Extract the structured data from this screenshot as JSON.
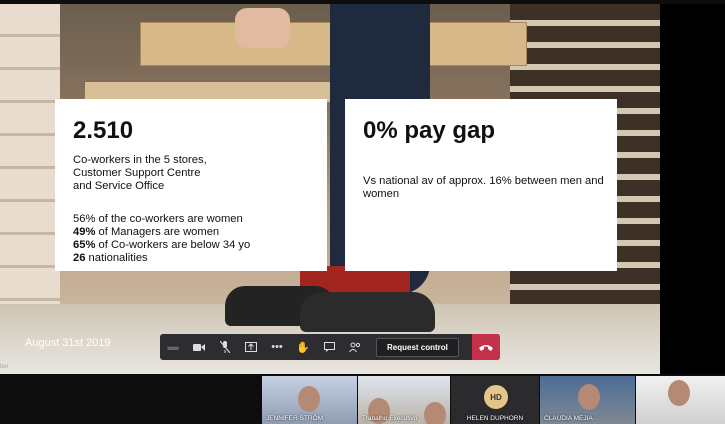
{
  "slide": {
    "card_left": {
      "headline": "2.510",
      "desc_lines": [
        "Co-workers in the 5 stores,",
        "Customer Support Centre",
        "and Service Office"
      ],
      "stats": [
        {
          "bold": "",
          "text": "56% of the co-workers are women"
        },
        {
          "bold": "49%",
          "text": " of Managers are women"
        },
        {
          "bold": "65%",
          "text": " of Co-workers are below 34 yo"
        },
        {
          "bold": "26",
          "text": " nationalities"
        }
      ]
    },
    "card_right": {
      "headline": "0% pay gap",
      "desc_lines": [
        "Vs national av of approx. 16% between men and",
        "women"
      ]
    },
    "date": "August 31st 2019"
  },
  "toolbar": {
    "icons": [
      "screen-icon",
      "camera-icon",
      "mic-off-icon",
      "share-icon",
      "more-icon",
      "raise-hand-icon",
      "chat-icon",
      "participants-icon"
    ],
    "request_control_label": "Request control",
    "hangup_icon": "phone-hangup-icon"
  },
  "corner_label": "ber",
  "participants": [
    {
      "name": "JENNIFER STRÖM"
    },
    {
      "name": "Trabalho Executivo"
    },
    {
      "name": "HELEN DUPHORN",
      "initials": "HD"
    },
    {
      "name": "CLAUDIA MEJIA"
    },
    {
      "name": ""
    }
  ],
  "colors": {
    "hangup": "#c4314b",
    "toolbar": "#2d2c30",
    "avatar": "#e6c58a"
  }
}
